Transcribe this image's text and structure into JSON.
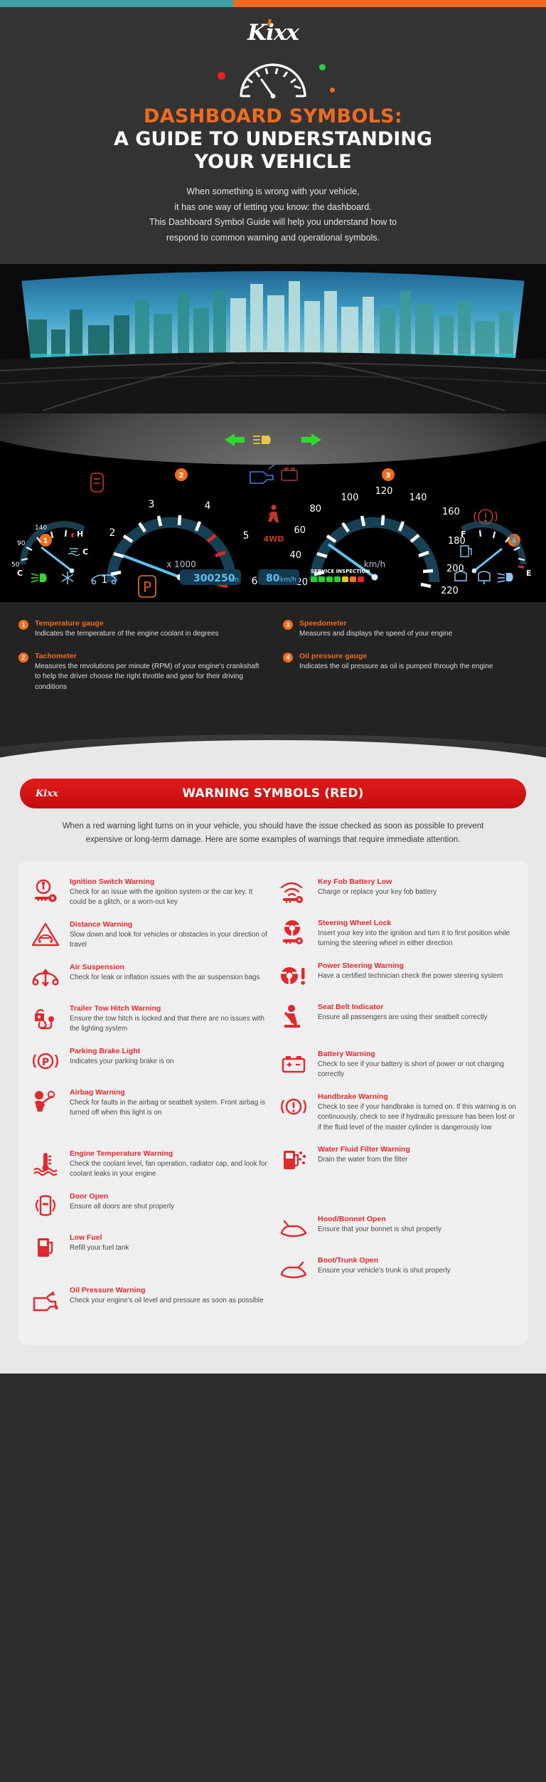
{
  "brand": {
    "name": "Kixx",
    "accent_orange": "#ef6c1f",
    "accent_red": "#e0282f",
    "accent_teal": "#3fa0a6"
  },
  "hero": {
    "title_line1": "DASHBOARD SYMBOLS:",
    "title_line2": "A GUIDE TO UNDERSTANDING",
    "title_line3": "YOUR VEHICLE",
    "intro_line1": "When something is wrong with your vehicle,",
    "intro_line2": "it has one way of letting you know: the dashboard.",
    "intro_line3": "This Dashboard Symbol Guide will help you understand how to",
    "intro_line4": "respond to common warning and operational symbols."
  },
  "cluster": {
    "tachometer": {
      "unit": "x 1000",
      "ticks": [
        "1",
        "2",
        "3",
        "4",
        "5",
        "6"
      ]
    },
    "speedometer": {
      "unit": "km/h",
      "ticks": [
        "20",
        "40",
        "60",
        "80",
        "100",
        "120",
        "140",
        "160",
        "180",
        "200",
        "220"
      ]
    },
    "temp_gauge": {
      "high": "140",
      "low": "50",
      "mid": "90",
      "h_label": "H",
      "c_label": "C"
    },
    "fuel_gauge": {
      "full": "F",
      "empty": "E"
    },
    "odometer": {
      "value": "300250",
      "unit": "km"
    },
    "speed_readout": {
      "value": "80",
      "unit": "km/h"
    },
    "service": {
      "label": "SERVICE INSPECTION"
    },
    "gear": "P",
    "drive_mode": "4WD"
  },
  "legend": {
    "left": [
      {
        "num": "1",
        "title": "Temperature gauge",
        "desc": "Indicates the temperature of the engine coolant in degrees"
      },
      {
        "num": "2",
        "title": "Tachometer",
        "desc": "Measures the revolutions per minute (RPM) of your engine's crankshaft to help the driver choose the right throttle and gear for their driving conditions"
      }
    ],
    "right": [
      {
        "num": "3",
        "title": "Speedometer",
        "desc": "Measures and displays the speed of your engine"
      },
      {
        "num": "4",
        "title": "Oil pressure gauge",
        "desc": "Indicates the oil pressure as oil is pumped through the engine"
      }
    ]
  },
  "red_section": {
    "banner_logo": "Kixx",
    "banner_title": "WARNING SYMBOLS (RED)",
    "intro": "When a red warning light turns on in your vehicle, you should have the issue checked as soon as possible to prevent expensive or long-term damage. Here are some examples of warnings that require immediate attention.",
    "left_items": [
      {
        "icon": "ignition-switch-icon",
        "title": "Ignition Switch Warning",
        "desc": "Check for an issue with the ignition system or the car key. It could be a glitch, or a worn-out key"
      },
      {
        "icon": "distance-warning-icon",
        "title": "Distance Warning",
        "desc": "Slow down and look for vehicles or obstacles in your direction of travel"
      },
      {
        "icon": "air-suspension-icon",
        "title": "Air Suspension",
        "desc": "Check for leak or inflation issues with the air suspension bags"
      },
      {
        "icon": "trailer-tow-hitch-icon",
        "title": "Trailer Tow Hitch Warning",
        "desc": "Ensure the tow hitch is locked and that there are no issues with the lighting system"
      },
      {
        "icon": "parking-brake-icon",
        "title": "Parking Brake Light",
        "desc": "Indicates your parking brake is on"
      },
      {
        "icon": "airbag-icon",
        "title": "Airbag Warning",
        "desc": "Check for faults in the airbag or seatbelt system. Front airbag is turned off when this light is on"
      },
      {
        "icon": "engine-temperature-icon",
        "title": "Engine Temperature Warning",
        "desc": "Check the coolant level, fan operation, radiator cap, and look for coolant leaks in your engine"
      },
      {
        "icon": "door-open-icon",
        "title": "Door Open",
        "desc": "Ensure all doors are shut properly"
      },
      {
        "icon": "low-fuel-icon",
        "title": "Low Fuel",
        "desc": "Refill your fuel tank"
      },
      {
        "icon": "oil-pressure-icon",
        "title": "Oil Pressure Warning",
        "desc": "Check your engine's oil level and pressure as soon as possible"
      }
    ],
    "right_items": [
      {
        "icon": "key-fob-battery-icon",
        "title": "Key Fob Battery Low",
        "desc": "Charge or replace your key fob battery"
      },
      {
        "icon": "steering-wheel-lock-icon",
        "title": "Steering Wheel Lock",
        "desc": "Insert your key into the ignition and turn it to first position while turning the steering wheel in either direction"
      },
      {
        "icon": "power-steering-icon",
        "title": "Power Steering Warning",
        "desc": "Have a certified technician check the power steering system"
      },
      {
        "icon": "seat-belt-icon",
        "title": "Seat Belt Indicator",
        "desc": "Ensure all passengers are using their seatbelt correctly"
      },
      {
        "icon": "battery-warning-icon",
        "title": "Battery Warning",
        "desc": "Check to see if your battery is short of power or not charging correctly"
      },
      {
        "icon": "handbrake-icon",
        "title": "Handbrake Warning",
        "desc": "Check to see if your handbrake is turned on. If this warning is on continuously, check to see if hydraulic pressure has been lost or if the fluid level of the master cylinder is dangerously low"
      },
      {
        "icon": "water-fluid-filter-icon",
        "title": "Water Fluid Filter Warning",
        "desc": "Drain the water from the filter"
      },
      {
        "icon": "hood-open-icon",
        "title": "Hood/Bonnet Open",
        "desc": "Ensure that your bonnet is shut properly"
      },
      {
        "icon": "boot-trunk-open-icon",
        "title": "Boot/Trunk Open",
        "desc": "Ensure your vehicle's trunk is shut properly"
      }
    ]
  }
}
